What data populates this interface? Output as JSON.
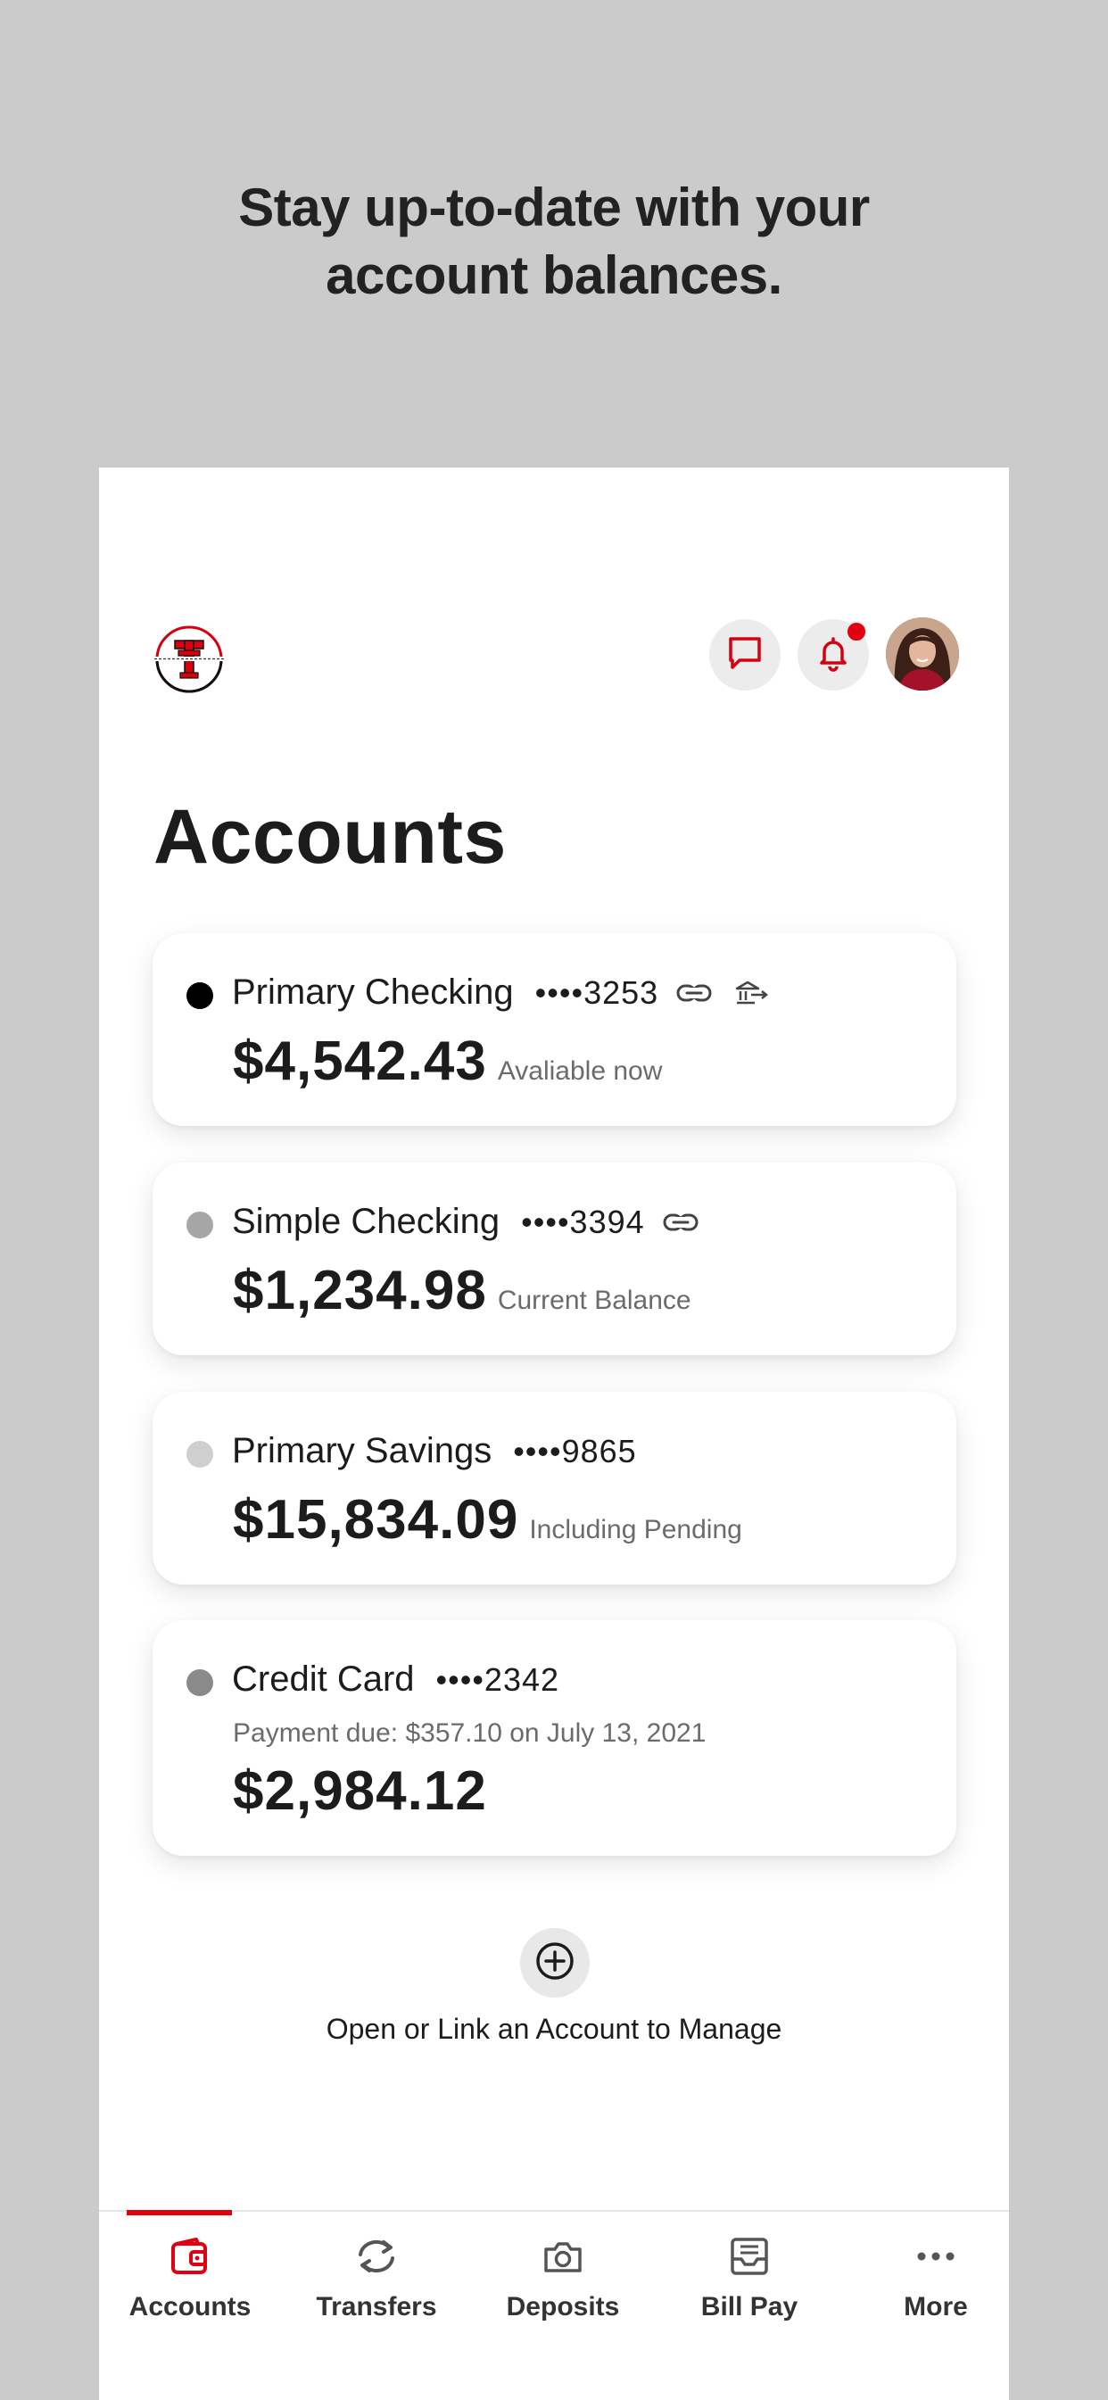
{
  "headline": {
    "line1": "Stay up-to-date with your",
    "line2": "account balances."
  },
  "header": {
    "logo_icon": "double-t-logo-icon",
    "chat_icon": "chat-icon",
    "bell_icon": "bell-icon",
    "has_notification": true,
    "avatar": "user-avatar"
  },
  "page_title": "Accounts",
  "accounts": [
    {
      "name": "Primary Checking",
      "mask": "••••3253",
      "balance": "$4,542.43",
      "note": "Avaliable now",
      "dot_color": "#000000",
      "icons": [
        "link-icon",
        "bank-transfer-icon"
      ]
    },
    {
      "name": "Simple Checking",
      "mask": "••••3394",
      "balance": "$1,234.98",
      "note": "Current Balance",
      "dot_color": "#a6a6a6",
      "icons": [
        "link-icon"
      ]
    },
    {
      "name": "Primary Savings",
      "mask": "••••9865",
      "balance": "$15,834.09",
      "note": "Including Pending",
      "dot_color": "#cfcfcf",
      "icons": []
    },
    {
      "name": "Credit Card",
      "mask": "••••2342",
      "due": "Payment due: $357.10 on July 13, 2021",
      "balance": "$2,984.12",
      "dot_color": "#8a8a8a",
      "icons": []
    }
  ],
  "add_account": {
    "icon": "plus-circle-icon",
    "label": "Open or Link an Account to Manage"
  },
  "tabbar": {
    "active": "Accounts",
    "items": [
      {
        "label": "Accounts",
        "icon": "wallet-icon"
      },
      {
        "label": "Transfers",
        "icon": "transfer-arrows-icon"
      },
      {
        "label": "Deposits",
        "icon": "camera-icon"
      },
      {
        "label": "Bill Pay",
        "icon": "bill-inbox-icon"
      },
      {
        "label": "More",
        "icon": "more-dots-icon"
      }
    ]
  },
  "colors": {
    "accent": "#e0000f",
    "background": "#cbcbcb",
    "card": "#ffffff"
  }
}
